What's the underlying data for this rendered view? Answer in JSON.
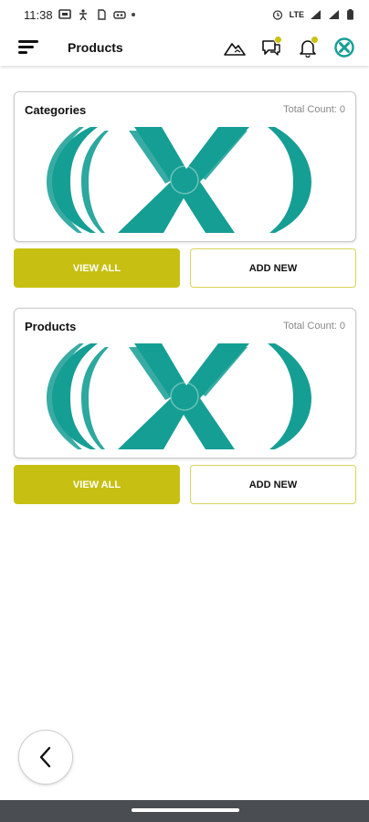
{
  "status_bar": {
    "time": "11:38",
    "network_label": "LTE",
    "icons": [
      "message-icon",
      "accessibility-icon",
      "sim-icon",
      "vr-icon",
      "alarm-icon",
      "signal-icon",
      "battery-icon"
    ]
  },
  "app_bar": {
    "title": "Products",
    "actions": [
      "mountain-icon",
      "chat-icon",
      "bell-icon",
      "logo-icon"
    ]
  },
  "sections": [
    {
      "title": "Categories",
      "count_label": "Total Count:",
      "count_value": "0",
      "view_all_label": "VIEW ALL",
      "add_new_label": "ADD NEW"
    },
    {
      "title": "Products",
      "count_label": "Total Count:",
      "count_value": "0",
      "view_all_label": "VIEW ALL",
      "add_new_label": "ADD NEW"
    }
  ],
  "colors": {
    "accent": "#c7c013",
    "logo_teal": "#159e94",
    "badge": "#c7c313"
  }
}
